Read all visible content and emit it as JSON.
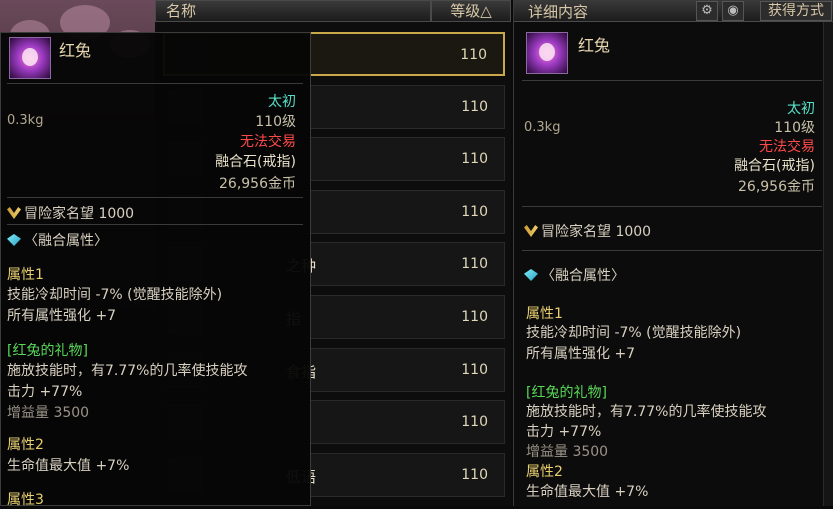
{
  "list": {
    "header_name": "名称",
    "header_level": "等级△",
    "rows": [
      {
        "name": "",
        "level": "110"
      },
      {
        "name": "",
        "level": "110"
      },
      {
        "name": "",
        "level": "110"
      },
      {
        "name": "",
        "level": "110"
      },
      {
        "name": "之种",
        "level": "110"
      },
      {
        "name": "指",
        "level": "110"
      },
      {
        "name": "食指",
        "level": "110"
      },
      {
        "name": "",
        "level": "110"
      },
      {
        "name": "低语",
        "level": "110"
      }
    ]
  },
  "detail": {
    "header_title": "详细内容",
    "source_button": "获得方式"
  },
  "item": {
    "name": "红兔",
    "weight": "0.3kg",
    "rarity": "太初",
    "level": "110级",
    "trade": "无法交易",
    "type": "融合石(戒指)",
    "price": "26,956金币",
    "fame_label": "冒险家名望",
    "fame_value": "1000",
    "fusion_title": "〈融合属性〉",
    "attr1_title": "属性1",
    "attr1_line1": "技能冷却时间 -7% (觉醒技能除外)",
    "attr1_line2": "所有属性强化 +7",
    "gift_title": "[红兔的礼物]",
    "gift_line1": "施放技能时，有7.77%的几率使技能攻",
    "gift_line2": "击力 +77%",
    "gift_line3": "增益量 3500",
    "attr2_title": "属性2",
    "attr2_line1": "生命值最大值 +7%",
    "attr3_title": "属性3"
  },
  "icons": [
    "wing-icon",
    "gem-icon",
    "gear-icon",
    "eye-icon"
  ],
  "colors": {
    "rarity": "#58e0c8",
    "untradeable": "#ff4a4a",
    "selected_border": "#c8a84a"
  }
}
